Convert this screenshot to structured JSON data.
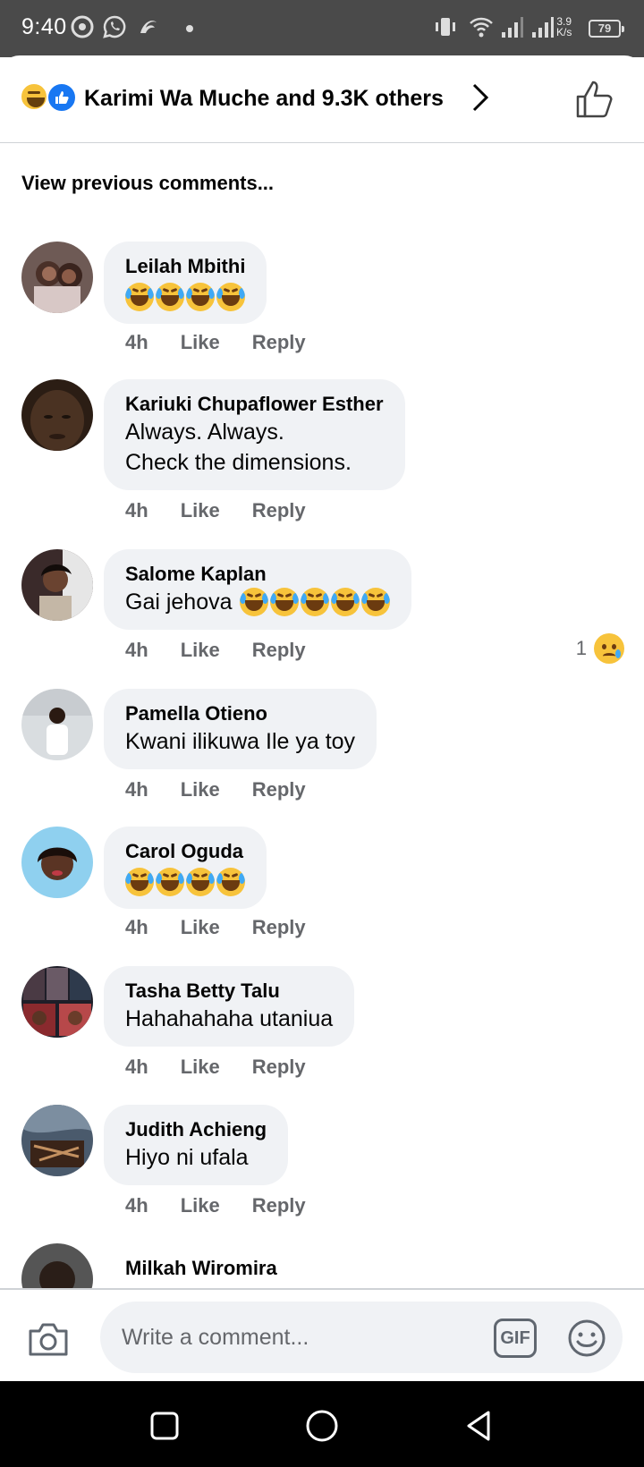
{
  "status_bar": {
    "time": "9:40",
    "net_speed_value": "3.9",
    "net_speed_unit": "K/s",
    "battery": "79"
  },
  "header": {
    "reactors_text": "Karimi Wa Muche and 9.3K others"
  },
  "view_previous": "View previous comments...",
  "comments": [
    {
      "name": "Leilah Mbithi",
      "text": "",
      "emoji_count": 4,
      "time": "4h",
      "like": "Like",
      "reply": "Reply"
    },
    {
      "name": "Kariuki Chupaflower Esther",
      "line1": "Always. Always.",
      "line2": "Check the dimensions.",
      "time": "4h",
      "like": "Like",
      "reply": "Reply"
    },
    {
      "name": "Salome Kaplan",
      "text": "Gai jehova",
      "time": "4h",
      "like": "Like",
      "reply": "Reply",
      "reaction_count": "1"
    },
    {
      "name": "Pamella Otieno",
      "text": "Kwani ilikuwa Ile ya toy",
      "time": "4h",
      "like": "Like",
      "reply": "Reply"
    },
    {
      "name": "Carol Oguda",
      "text": "",
      "time": "4h",
      "like": "Like",
      "reply": "Reply"
    },
    {
      "name": "Tasha Betty Talu",
      "text": "Hahahahaha utaniua",
      "time": "4h",
      "like": "Like",
      "reply": "Reply"
    },
    {
      "name": "Judith Achieng",
      "text": "Hiyo ni ufala",
      "time": "4h",
      "like": "Like",
      "reply": "Reply"
    },
    {
      "name": "Milkah Wiromira"
    }
  ],
  "composer": {
    "placeholder": "Write a comment...",
    "gif_label": "GIF"
  },
  "colors": {
    "bubble": "#f0f2f5",
    "meta": "#65676b",
    "like_blue": "#1877f2",
    "emoji_yellow": "#f7c33b"
  }
}
